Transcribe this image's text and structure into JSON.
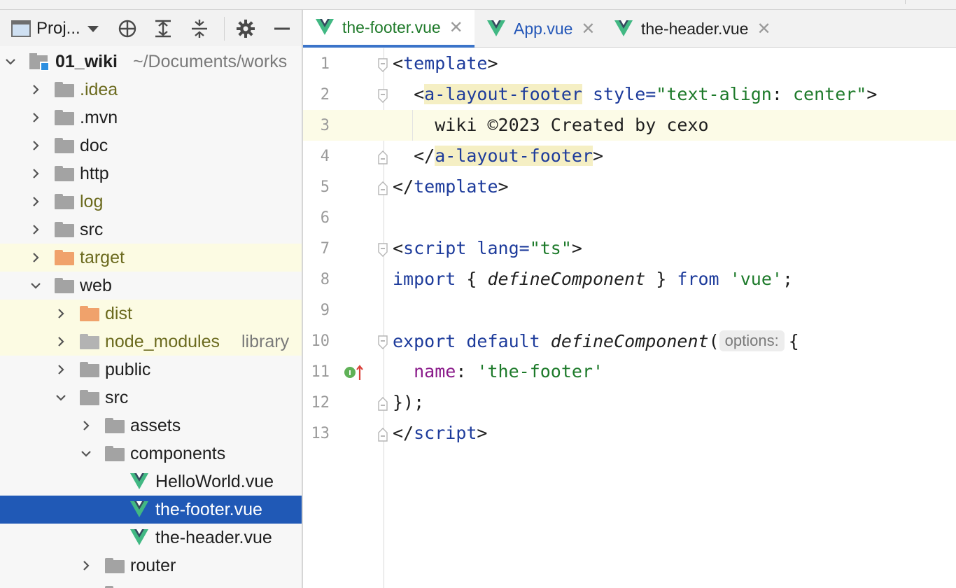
{
  "project_panel": {
    "selector_label": "Proj...",
    "tree": [
      {
        "label": "01_wiki",
        "sub": "~/Documents/works",
        "level": 0,
        "expanded": true,
        "kind": "module"
      },
      {
        "label": ".idea",
        "level": 1,
        "expanded": false,
        "kind": "folder",
        "color": "olive"
      },
      {
        "label": ".mvn",
        "level": 1,
        "expanded": false,
        "kind": "folder"
      },
      {
        "label": "doc",
        "level": 1,
        "expanded": false,
        "kind": "folder"
      },
      {
        "label": "http",
        "level": 1,
        "expanded": false,
        "kind": "folder"
      },
      {
        "label": "log",
        "level": 1,
        "expanded": false,
        "kind": "folder",
        "color": "olive"
      },
      {
        "label": "src",
        "level": 1,
        "expanded": false,
        "kind": "folder"
      },
      {
        "label": "target",
        "level": 1,
        "expanded": false,
        "kind": "folder-excluded",
        "color": "olive",
        "highlight": true
      },
      {
        "label": "web",
        "level": 1,
        "expanded": true,
        "kind": "folder"
      },
      {
        "label": "dist",
        "level": 2,
        "expanded": false,
        "kind": "folder-excluded",
        "color": "olive",
        "highlight": true
      },
      {
        "label": "node_modules",
        "sub": "library",
        "level": 2,
        "expanded": false,
        "kind": "folder-light",
        "color": "olive",
        "highlight": true
      },
      {
        "label": "public",
        "level": 2,
        "expanded": false,
        "kind": "folder"
      },
      {
        "label": "src",
        "level": 2,
        "expanded": true,
        "kind": "folder"
      },
      {
        "label": "assets",
        "level": 3,
        "expanded": false,
        "kind": "folder"
      },
      {
        "label": "components",
        "level": 3,
        "expanded": true,
        "kind": "folder"
      },
      {
        "label": "HelloWorld.vue",
        "level": 4,
        "kind": "vue"
      },
      {
        "label": "the-footer.vue",
        "level": 4,
        "kind": "vue",
        "selected": true
      },
      {
        "label": "the-header.vue",
        "level": 4,
        "kind": "vue"
      },
      {
        "label": "router",
        "level": 3,
        "expanded": false,
        "kind": "folder"
      }
    ]
  },
  "editor": {
    "tabs": [
      {
        "label": "the-footer.vue",
        "active": true
      },
      {
        "label": "App.vue",
        "active": false
      },
      {
        "label": "the-header.vue",
        "active": false
      }
    ],
    "line_numbers": [
      "1",
      "2",
      "3",
      "4",
      "5",
      "6",
      "7",
      "8",
      "9",
      "10",
      "11",
      "12",
      "13"
    ],
    "code": {
      "l1_open": "<",
      "l1_tag": "template",
      "l1_close": ">",
      "l2_indent": "  <",
      "l2_tag": "a-layout-footer",
      "l2_attr": " style=",
      "l2_str": "\"text-align",
      "l2_colon": ": ",
      "l2_val": "center\"",
      "l2_close": ">",
      "l3_text": "    wiki ©2023 Created by cexo",
      "l4_indent": "  </",
      "l4_tag": "a-layout-footer",
      "l4_close": ">",
      "l5_open": "</",
      "l5_tag": "template",
      "l5_close": ">",
      "l7_open": "<",
      "l7_tag": "script",
      "l7_attr": " lang=",
      "l7_str": "\"ts\"",
      "l7_close": ">",
      "l8_kw": "import",
      "l8_mid1": " { ",
      "l8_fn": "defineComponent",
      "l8_mid2": " } ",
      "l8_kw2": "from",
      "l8_sp": " ",
      "l8_str": "'vue'",
      "l8_end": ";",
      "l10_kw1": "export",
      "l10_sp1": " ",
      "l10_kw2": "default",
      "l10_sp2": " ",
      "l10_fn": "defineComponent",
      "l10_paren": "(",
      "l10_hint": "options:",
      "l10_brace": "{",
      "l11_indent": "  ",
      "l11_prop": "name",
      "l11_colon": ": ",
      "l11_str": "'the-footer'",
      "l12_text": "});",
      "l13_open": "</",
      "l13_tag": "script",
      "l13_close": ">"
    }
  },
  "colors": {
    "selection": "#2059b6",
    "vue_green": "#41b883",
    "vue_dark": "#35495e",
    "tag_blue": "#1d3b9b",
    "string_green": "#1d7a2a"
  },
  "icons": [
    "project-window-icon",
    "locate-icon",
    "expand-all-icon",
    "collapse-all-icon",
    "gear-icon",
    "minimize-icon",
    "vue-file-icon",
    "folder-icon",
    "implements-icon"
  ]
}
